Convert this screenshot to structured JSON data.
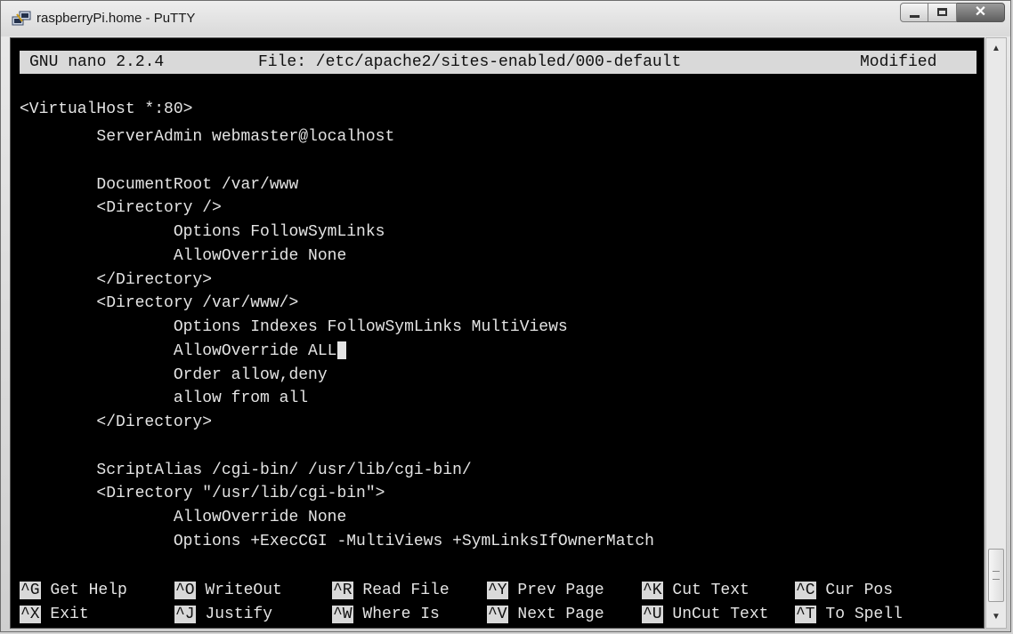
{
  "window": {
    "title": "raspberryPi.home - PuTTY",
    "icon": "putty-icon",
    "buttons": {
      "minimize": "minimize-icon",
      "maximize": "maximize-icon",
      "close": "✕"
    }
  },
  "nano": {
    "version": "GNU nano 2.2.4",
    "file": "File: /etc/apache2/sites-enabled/000-default",
    "status": "Modified"
  },
  "lines": [
    "<VirtualHost *:80>",
    "        ServerAdmin webmaster@localhost",
    "",
    "        DocumentRoot /var/www",
    "        <Directory />",
    "                Options FollowSymLinks",
    "                AllowOverride None",
    "        </Directory>",
    "        <Directory /var/www/>",
    "                Options Indexes FollowSymLinks MultiViews",
    "                AllowOverride ALL",
    "                Order allow,deny",
    "                allow from all",
    "        </Directory>",
    "",
    "        ScriptAlias /cgi-bin/ /usr/lib/cgi-bin/",
    "        <Directory \"/usr/lib/cgi-bin\">",
    "                AllowOverride None",
    "                Options +ExecCGI -MultiViews +SymLinksIfOwnerMatch"
  ],
  "shortcuts": {
    "row1": [
      {
        "key": "^G",
        "label": " Get Help"
      },
      {
        "key": "^O",
        "label": " WriteOut"
      },
      {
        "key": "^R",
        "label": " Read File"
      },
      {
        "key": "^Y",
        "label": " Prev Page"
      },
      {
        "key": "^K",
        "label": " Cut Text"
      },
      {
        "key": "^C",
        "label": " Cur Pos"
      }
    ],
    "row2": [
      {
        "key": "^X",
        "label": " Exit"
      },
      {
        "key": "^J",
        "label": " Justify"
      },
      {
        "key": "^W",
        "label": " Where Is"
      },
      {
        "key": "^V",
        "label": " Next Page"
      },
      {
        "key": "^U",
        "label": " UnCut Text"
      },
      {
        "key": "^T",
        "label": " To Spell"
      }
    ]
  },
  "scrollbar": {
    "up": "▲",
    "down": "▼"
  },
  "colors": {
    "terminal_bg": "#000000",
    "terminal_fg": "#e4e4e4",
    "highlight_bg": "#d9d9d9"
  }
}
